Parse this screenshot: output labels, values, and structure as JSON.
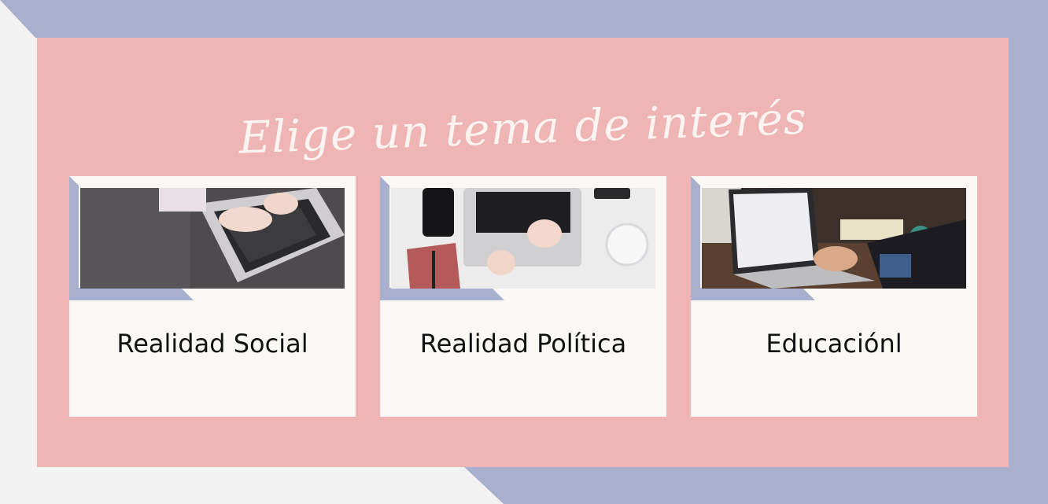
{
  "page": {
    "title": "Elige un tema de interés"
  },
  "colors": {
    "background": "#f2f2f2",
    "accent_lavender": "#a9afce",
    "panel_pink": "#efb4b4",
    "card_bg": "#faf8f5",
    "title_color": "#fbf4f0"
  },
  "cards": [
    {
      "label": "Realidad Social",
      "image": "laptop-typing-on-sofa"
    },
    {
      "label": "Realidad Política",
      "image": "laptop-desk-with-phone-notebook"
    },
    {
      "label": "Educaciónl",
      "image": "laptop-on-wooden-desk"
    }
  ]
}
